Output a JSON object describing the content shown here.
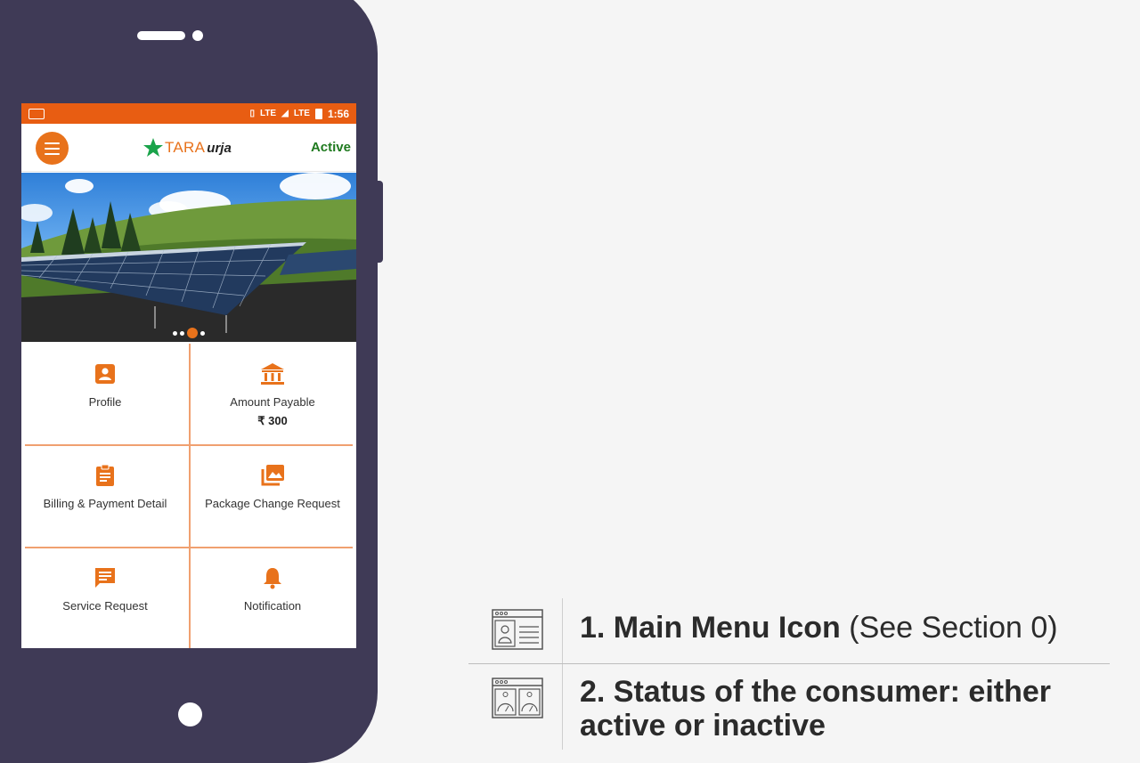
{
  "status_bar": {
    "time": "1:56",
    "network_1": "LTE",
    "network_2": "LTE"
  },
  "app_bar": {
    "logo_primary": "TARA",
    "logo_secondary": "urja",
    "status": "Active"
  },
  "banner": {
    "slides_count": 4,
    "active_slide": 3
  },
  "menu": {
    "profile": {
      "label": "Profile",
      "icon": "person-badge-icon"
    },
    "amount_payable": {
      "label": "Amount Payable",
      "amount": "₹ 300",
      "icon": "bank-icon"
    },
    "billing": {
      "label": "Billing & Payment Detail",
      "icon": "clipboard-icon"
    },
    "package": {
      "label": "Package Change Request",
      "icon": "gallery-icon"
    },
    "service": {
      "label": "Service Request",
      "icon": "chat-icon"
    },
    "notification": {
      "label": "Notification",
      "icon": "bell-icon"
    }
  },
  "legend": {
    "item1": {
      "bold": "1. Main Menu Icon",
      "normal": " (See Section 0)"
    },
    "item2": {
      "bold": "2. Status of the consumer: either active or inactive"
    }
  },
  "colors": {
    "accent": "#e8721b",
    "status_bar": "#e85d12",
    "phone_body": "#3f3a56",
    "active_status": "#1f7a1f"
  }
}
